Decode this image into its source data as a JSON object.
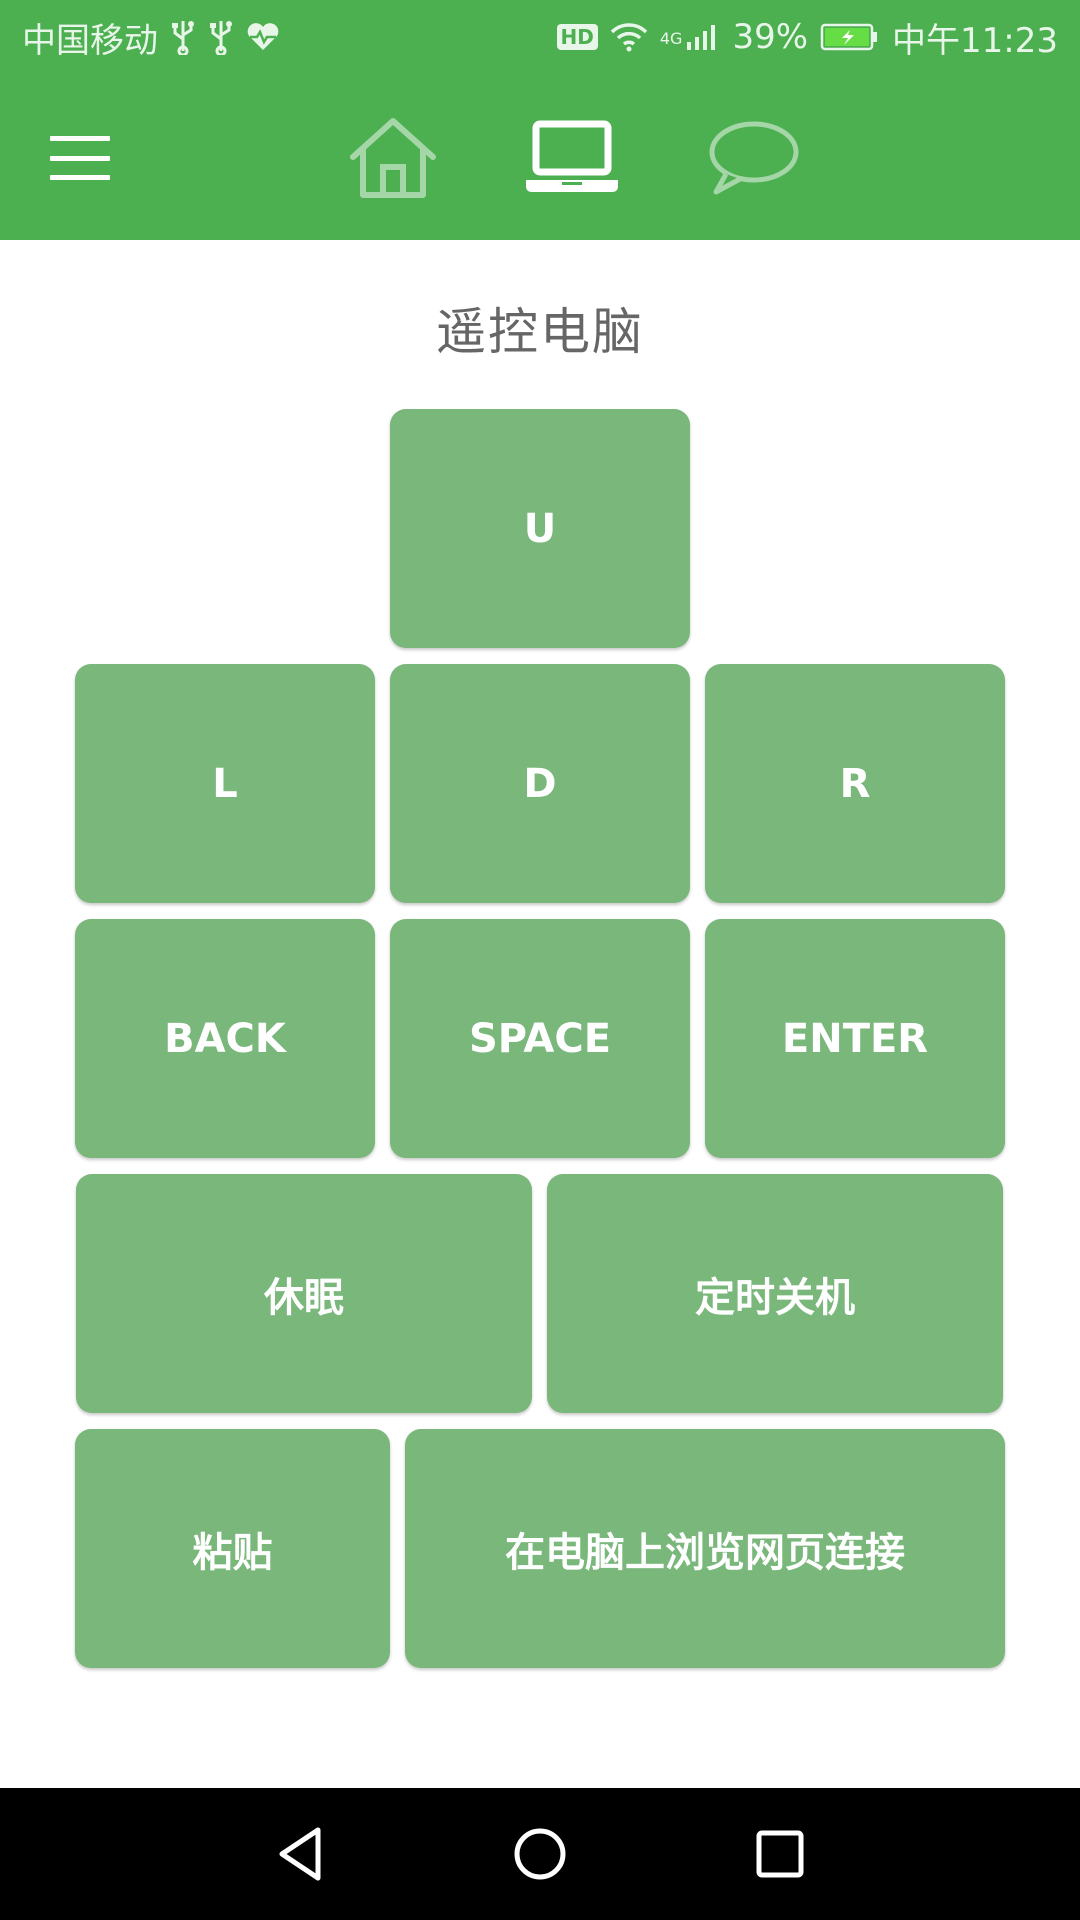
{
  "status_bar": {
    "carrier": "中国移动",
    "hd": "HD",
    "network": "4G",
    "battery": "39%",
    "time": "中午11:23",
    "icons": [
      "usb-icon",
      "usb-icon",
      "heart-health-icon",
      "wifi-icon",
      "signal-icon",
      "battery-charging-icon"
    ]
  },
  "app_bar": {
    "menu_icon": "hamburger-menu-icon",
    "tabs": [
      {
        "icon": "home-icon",
        "active": false
      },
      {
        "icon": "laptop-icon",
        "active": true
      },
      {
        "icon": "chat-bubble-icon",
        "active": false
      }
    ]
  },
  "page": {
    "title": "遥控电脑"
  },
  "keys": {
    "up": "U",
    "left": "L",
    "down": "D",
    "right": "R",
    "back": "BACK",
    "space": "SPACE",
    "enter": "ENTER",
    "sleep": "休眠",
    "timed_shutdown": "定时关机",
    "paste": "粘贴",
    "browse_on_pc": "在电脑上浏览网页连接"
  },
  "colors": {
    "primary": "#4caf50",
    "key": "#79b77b",
    "title_text": "#666666"
  },
  "system_nav": [
    "back-triangle-icon",
    "home-circle-icon",
    "recents-square-icon"
  ]
}
